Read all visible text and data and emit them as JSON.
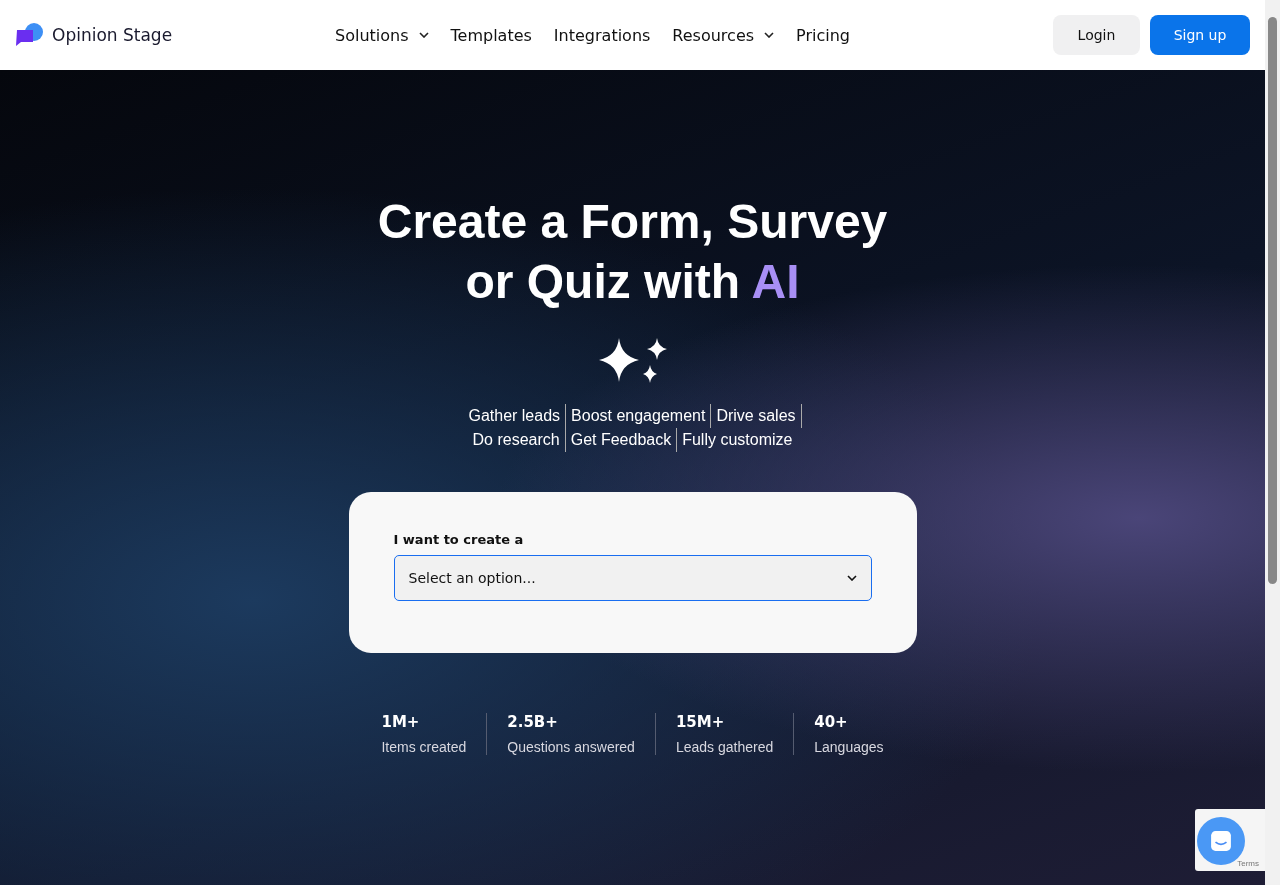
{
  "header": {
    "brand": "Opinion Stage",
    "nav": [
      {
        "label": "Solutions",
        "has_menu": true
      },
      {
        "label": "Templates",
        "has_menu": false
      },
      {
        "label": "Integrations",
        "has_menu": false
      },
      {
        "label": "Resources",
        "has_menu": true
      },
      {
        "label": "Pricing",
        "has_menu": false
      }
    ],
    "login": "Login",
    "signup": "Sign up"
  },
  "hero": {
    "title": "Create a Form, Survey or Quiz with",
    "title_highlight": "AI",
    "tagline": [
      [
        "Gather leads",
        "Boost engagement",
        "Drive sales"
      ],
      [
        "Do research",
        "Get Feedback",
        "Fully customize"
      ]
    ],
    "form": {
      "label": "I want to create a",
      "select": "Select an option..."
    },
    "stats": [
      {
        "value": "1M+",
        "label": "Items created"
      },
      {
        "value": "2.5B+",
        "label": "Questions answered"
      },
      {
        "value": "15M+",
        "label": "Leads gathered"
      },
      {
        "value": "40+",
        "label": "Languages"
      }
    ]
  },
  "recaptcha": {
    "text": "Terms"
  }
}
